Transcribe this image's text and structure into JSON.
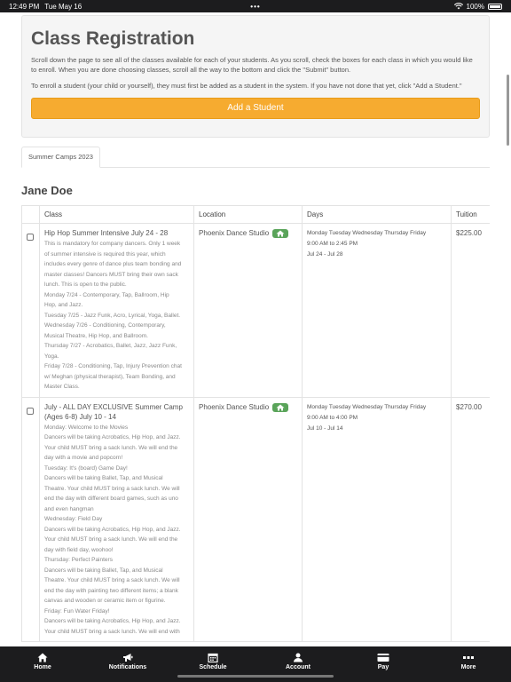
{
  "status_bar": {
    "time": "12:49 PM",
    "date": "Tue May 16",
    "dots": "•••",
    "battery": "100%"
  },
  "header": {
    "title": "Class Registration",
    "paragraph1": "Scroll down the page to see all of the classes available for each of your students. As you scroll, check the boxes for each class in which you would like to enroll. When you are done choosing classes, scroll all the way to the bottom and click the \"Submit\" button.",
    "paragraph2": "To enroll a student (your child or yourself), they must first be added as a student in the system. If you have not done that yet, click \"Add a Student.\"",
    "add_student_label": "Add a Student"
  },
  "tabs": [
    {
      "label": "Summer Camps 2023"
    }
  ],
  "student": {
    "name": "Jane Doe"
  },
  "table": {
    "headers": {
      "class": "Class",
      "location": "Location",
      "days": "Days",
      "tuition": "Tuition"
    },
    "rows": [
      {
        "title": "Hip Hop Summer Intensive July 24 - 28",
        "description": [
          "This is mandatory for company dancers. Only 1 week",
          "of summer intensive is required this year, which",
          "includes every genre of dance plus team bonding and",
          "master classes! Dancers MUST bring their own sack",
          "lunch. This is open to the public.",
          "Monday 7/24 - Contemporary, Tap, Ballroom, Hip",
          "Hop, and Jazz.",
          "Tuesday 7/25 - Jazz Funk, Acro, Lyrical, Yoga, Ballet.",
          "Wednesday 7/26 - Conditioning, Contemporary,",
          "Musical Theatre, Hip Hop, and Ballroom.",
          "Thursday 7/27 - Acrobatics, Ballet, Jazz, Jazz Funk,",
          "Yoga.",
          "Friday 7/28 - Conditioning, Tap, Injury Prevention chat",
          "w/ Meghan (physical therapist), Team Bonding, and",
          "Master Class."
        ],
        "location": "Phoenix Dance Studio",
        "days_line1": "Monday Tuesday Wednesday Thursday Friday",
        "days_line2": "9:00 AM to 2:45 PM",
        "days_line3": "Jul 24 - Jul 28",
        "tuition": "$225.00"
      },
      {
        "title": "July - ALL DAY EXCLUSIVE Summer Camp (Ages 6-8) July 10 - 14",
        "description": [
          "Monday: Welcome to the Movies",
          "Dancers will be taking Acrobatics, Hip Hop, and Jazz.",
          "Your child MUST bring a sack lunch. We will end the",
          "day with a movie and popcorn!",
          "Tuesday: It's (board) Game Day!",
          "Dancers will be taking Ballet, Tap, and Musical",
          "Theatre. Your child MUST bring a sack lunch. We will",
          "end the day with different board games, such as uno",
          "and even hangman",
          "Wednesday: Field Day",
          "Dancers will be taking Acrobatics, Hip Hop, and Jazz.",
          "Your child MUST bring a sack lunch. We will end the",
          "day with field day, woohoo!",
          "Thursday: Perfect Painters",
          "Dancers will be taking Ballet, Tap, and Musical",
          "Theatre. Your child MUST bring a sack lunch. We will",
          "end the day with painting two different items; a blank",
          "canvas and wooden or ceramic item or figurine.",
          "Friday: Fun Water Friday!",
          "Dancers will be taking Acrobatics, Hip Hop, and Jazz.",
          "Your child MUST bring a sack lunch. We will end with"
        ],
        "location": "Phoenix Dance Studio",
        "days_line1": "Monday Tuesday Wednesday Thursday Friday",
        "days_line2": "9:00 AM to 4:00 PM",
        "days_line3": "Jul 10 - Jul 14",
        "tuition": "$270.00"
      }
    ]
  },
  "tabbar": [
    {
      "label": "Home",
      "icon": "home-icon"
    },
    {
      "label": "Notifications",
      "icon": "megaphone-icon"
    },
    {
      "label": "Schedule",
      "icon": "calendar-icon"
    },
    {
      "label": "Account",
      "icon": "person-icon"
    },
    {
      "label": "Pay",
      "icon": "card-icon"
    },
    {
      "label": "More",
      "icon": "more-icon"
    }
  ]
}
